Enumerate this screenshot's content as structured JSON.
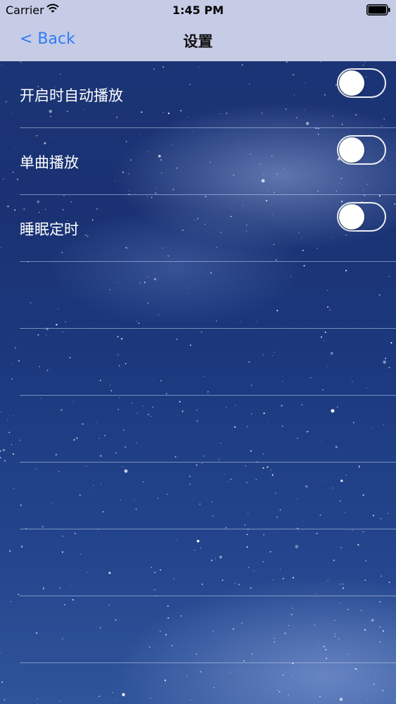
{
  "status_bar": {
    "carrier": "Carrier",
    "time": "1:45 PM",
    "wifi_icon": "wifi-icon",
    "battery_icon": "battery-icon",
    "battery_level": 1.0
  },
  "nav": {
    "back_label": "< Back",
    "title": "设置"
  },
  "settings": [
    {
      "label": "开启时自动播放",
      "on": false
    },
    {
      "label": "单曲播放",
      "on": false
    },
    {
      "label": "睡眠定时",
      "on": false
    }
  ],
  "colors": {
    "nav_background": "#c6cce6",
    "back_link": "#2f7bf6",
    "sky": "#1a3273",
    "separator": "#c3d2f0"
  }
}
